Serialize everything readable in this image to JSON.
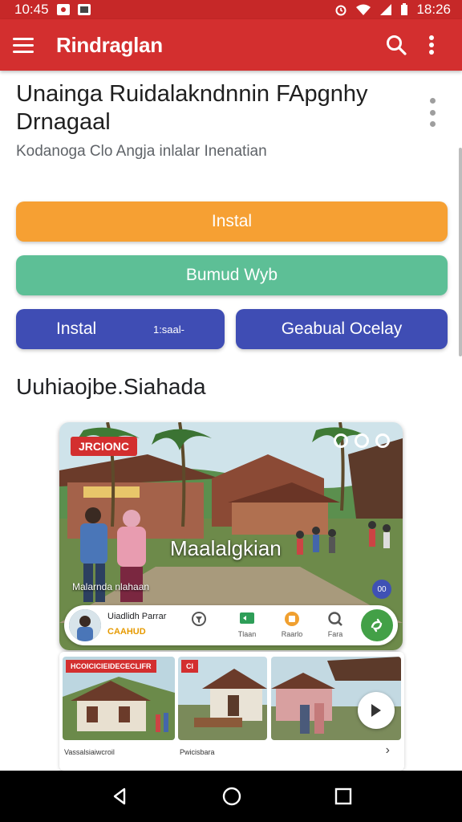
{
  "status_bar": {
    "time_left": "10:45",
    "time_right": "18:26"
  },
  "app_bar": {
    "title": "Rindraglan"
  },
  "header": {
    "headline": "Unainga Ruidalakndnnin FApgnhy Drnagaal",
    "subtitle": "Kodanoga Clo Angja inlalar Inenatian"
  },
  "buttons": {
    "install": "Instal",
    "secondary": "Bumud Wyb",
    "install_small": "Instal",
    "install_small_tag": "1:saal-",
    "google": "Geabual Ocelay"
  },
  "section": {
    "title": "Uuhiaojbe.Siahada"
  },
  "hero": {
    "badge": "JRCIONC",
    "caption": "Maalalgkian",
    "sub_caption": "Malarnda nlahaan",
    "corner_label": "00"
  },
  "toolbar": {
    "name": "Uiadlidh Parrar",
    "tag": "CAAHUD",
    "tools": [
      "",
      "Tlaan",
      "Raarlo",
      "Fara"
    ]
  },
  "thumbs": {
    "badge_1": "HCOICICIEIDECECLIFR",
    "badge_2": "CI",
    "caption_1": "Vassalsiaiwcroil",
    "caption_2": "Pwicisbara"
  },
  "colors": {
    "status_red": "#c62828",
    "appbar_red": "#d32f2f",
    "orange": "#f6a033",
    "teal": "#5dbf96",
    "indigo": "#3f4db4",
    "green": "#43a047"
  }
}
